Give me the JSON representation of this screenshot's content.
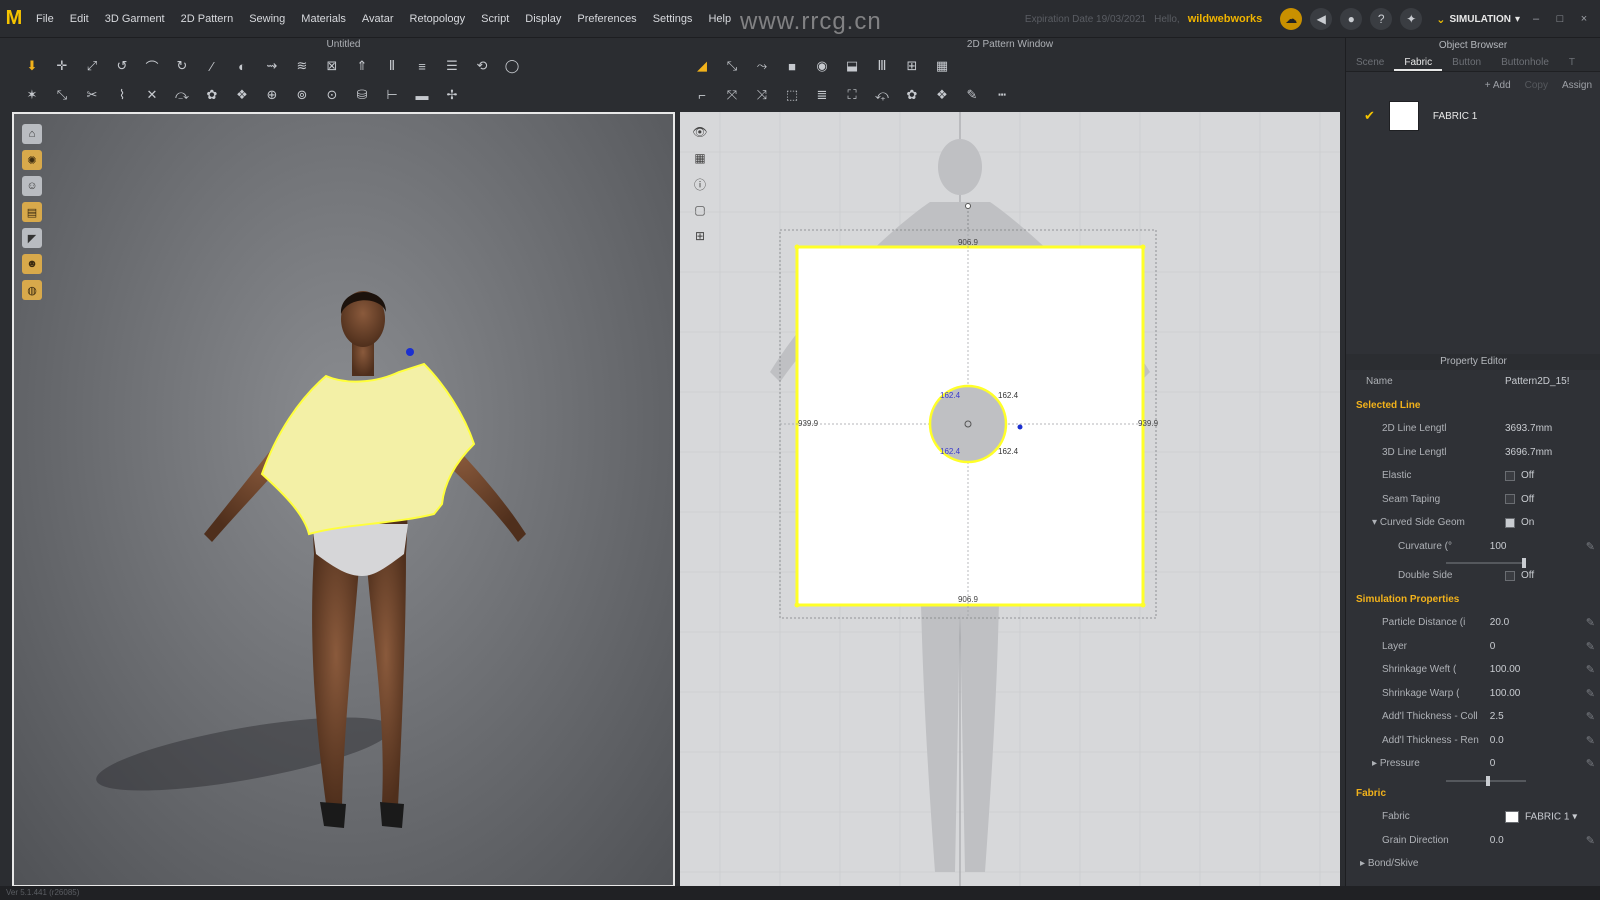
{
  "menu": [
    "File",
    "Edit",
    "3D Garment",
    "2D Pattern",
    "Sewing",
    "Materials",
    "Avatar",
    "Retopology",
    "Script",
    "Display",
    "Preferences",
    "Settings",
    "Help"
  ],
  "header": {
    "watermark": "www.rrcg.cn",
    "expiration": "Expiration Date 19/03/2021",
    "hello": "Hello,",
    "username": "wildwebworks",
    "mode": "SIMULATION"
  },
  "panels": {
    "viewport3d_title": "Untitled",
    "pattern_title": "2D Pattern Window",
    "object_browser_title": "Object Browser",
    "property_editor_title": "Property Editor"
  },
  "pattern": {
    "top_dim": "906.9",
    "bottom_dim": "906.9",
    "left_dim": "939.9",
    "right_dim": "939.9",
    "arc_tl": "162.4",
    "arc_tr": "162.4",
    "arc_bl": "162.4",
    "arc_br": "162.4"
  },
  "object_browser": {
    "tabs": [
      "Scene",
      "Fabric",
      "Button",
      "Buttonhole",
      "T"
    ],
    "active_tab": "Fabric",
    "add": "+ Add",
    "copy": "Copy",
    "assign": "Assign",
    "fabric_name": "FABRIC 1"
  },
  "property_editor": {
    "name_label": "Name",
    "name_value": "Pattern2D_15!",
    "selected_line": "Selected Line",
    "line2d_label": "2D Line Lengtl",
    "line2d_value": "3693.7mm",
    "line3d_label": "3D Line Lengtl",
    "line3d_value": "3696.7mm",
    "elastic_label": "Elastic",
    "elastic_value": "Off",
    "seam_label": "Seam Taping",
    "seam_value": "Off",
    "curved_label": "Curved Side Geom",
    "curved_value": "On",
    "curvature_label": "Curvature (°",
    "curvature_value": "100",
    "double_label": "Double Side",
    "double_value": "Off",
    "sim_props": "Simulation Properties",
    "particle_label": "Particle Distance (i",
    "particle_value": "20.0",
    "layer_label": "Layer",
    "layer_value": "0",
    "weft_label": "Shrinkage Weft (",
    "weft_value": "100.00",
    "warp_label": "Shrinkage Warp (",
    "warp_value": "100.00",
    "thick_coll_label": "Add'l Thickness - Coll",
    "thick_coll_value": "2.5",
    "thick_ren_label": "Add'l Thickness - Ren",
    "thick_ren_value": "0.0",
    "pressure_label": "Pressure",
    "pressure_value": "0",
    "fabric_section": "Fabric",
    "fabric_label": "Fabric",
    "fabric_value": "FABRIC 1",
    "grain_label": "Grain Direction",
    "grain_value": "0.0",
    "bond_label": "Bond/Skive"
  },
  "status": "Ver 5.1.441 (r26085)",
  "colors": {
    "accent": "#f2b21b",
    "selection": "#ffff3c",
    "fabric_yellow": "#f3f0a6"
  }
}
